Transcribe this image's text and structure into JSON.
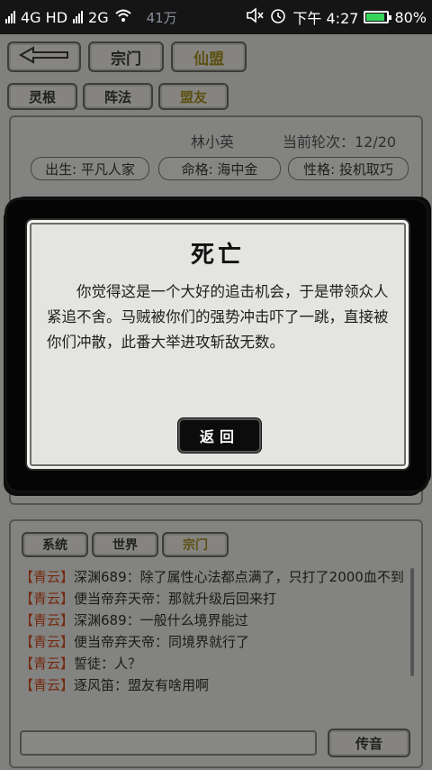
{
  "status_bar": {
    "network": "4G HD",
    "network2": "2G",
    "time": "下午 4:27",
    "battery": "80%",
    "battery_color": "#35d45a"
  },
  "game_header": {
    "gold": "41万",
    "back_arrow": "back-arrow-icon",
    "tabs": [
      "宗门",
      "仙盟"
    ],
    "active_tab": "仙盟"
  },
  "subtabs": [
    "灵根",
    "阵法",
    "盟友"
  ],
  "profile": {
    "name": "林小英",
    "round": "当前轮次：12/20",
    "tags": [
      "出生: 平凡人家",
      "命格:  海中金",
      "性格: 投机取巧"
    ]
  },
  "modal": {
    "title": "死亡",
    "text": "你觉得这是一个大好的追击机会，于是带领众人紧追不舍。马贼被你们的强势冲击吓了一跳，直接被你们冲散，此番大举进攻斩敌无数。",
    "return_label": "返回"
  },
  "chat": {
    "tabs": [
      "系统",
      "世界",
      "宗门"
    ],
    "active_tab": "宗门",
    "messages": [
      {
        "channel": "【青云】",
        "text": "深渊689：除了属性心法都点满了，只打了2000血不到"
      },
      {
        "channel": "【青云】",
        "text": "便当帝弃天帝：那就升级后回来打"
      },
      {
        "channel": "【青云】",
        "text": "深渊689：一般什么境界能过"
      },
      {
        "channel": "【青云】",
        "text": "便当帝弃天帝：同境界就行了"
      },
      {
        "channel": "【青云】",
        "text": "誓徒：人？"
      },
      {
        "channel": "【青云】",
        "text": "逐风笛：盟友有啥用啊"
      }
    ],
    "send_label": "传音",
    "input_value": ""
  }
}
